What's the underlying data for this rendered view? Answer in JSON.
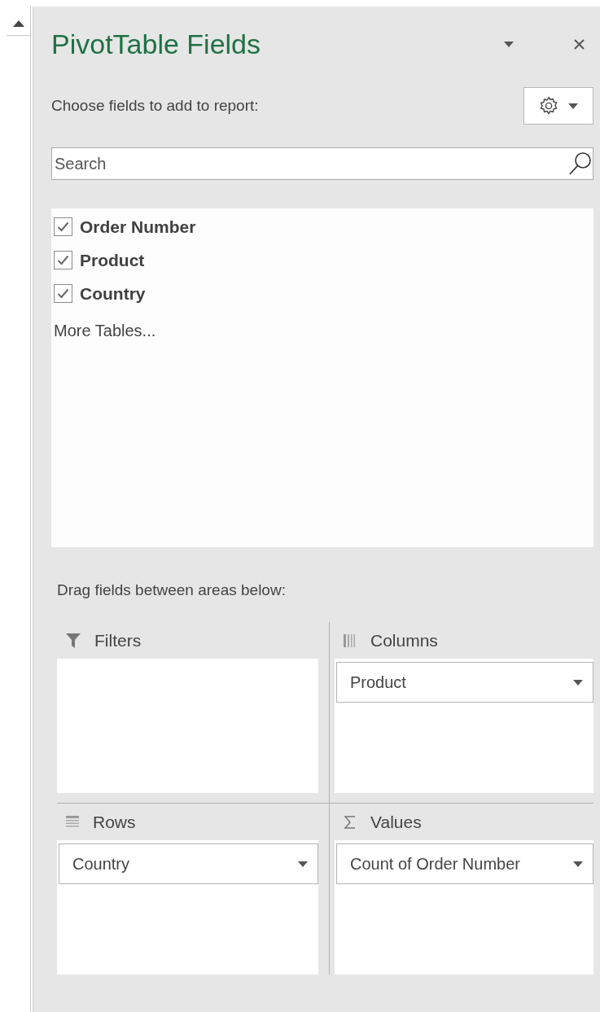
{
  "title": "PivotTable Fields",
  "subtitle": "Choose fields to add to report:",
  "search": {
    "placeholder": "Search"
  },
  "fields": [
    {
      "label": "Order Number",
      "checked": true
    },
    {
      "label": "Product",
      "checked": true
    },
    {
      "label": "Country",
      "checked": true
    }
  ],
  "more_tables": "More Tables...",
  "areas_heading": "Drag fields between areas below:",
  "areas": [
    {
      "kind": "filters",
      "label": "Filters"
    },
    {
      "kind": "columns",
      "label": "Columns",
      "items": [
        "Product"
      ]
    },
    {
      "kind": "rows",
      "label": "Rows",
      "items": [
        "Country"
      ]
    },
    {
      "kind": "values",
      "label": "Values",
      "items": [
        "Count of Order Number"
      ]
    }
  ]
}
